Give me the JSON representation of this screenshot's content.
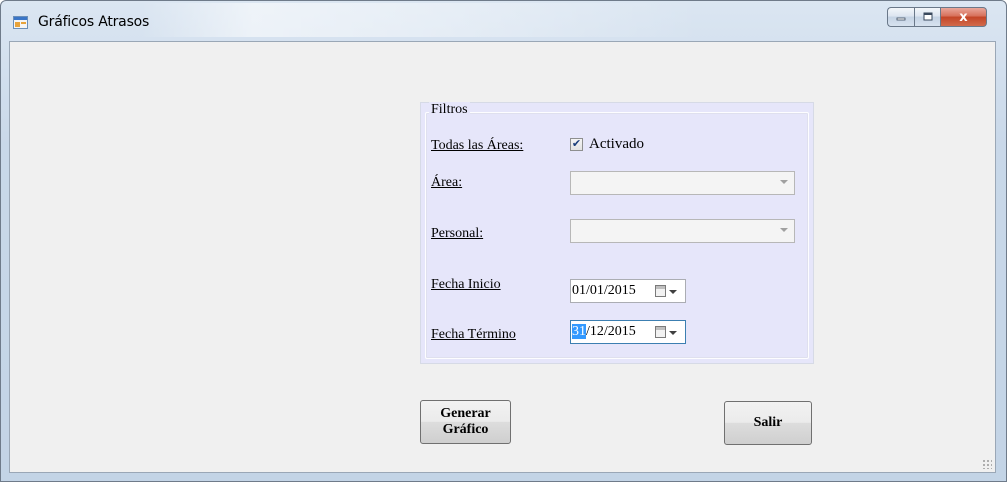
{
  "window": {
    "title": "Gráficos Atrasos",
    "close_glyph": "x",
    "icons": {
      "app": "form-icon",
      "minimize": "minimize-icon",
      "maximize": "maximize-icon",
      "close": "close-icon"
    }
  },
  "filters": {
    "group_title": "Filtros",
    "all_areas": {
      "label": "Todas las Áreas:",
      "checked": true,
      "checkbox_text": "Activado"
    },
    "area": {
      "label": "Área:",
      "value": "",
      "enabled": false
    },
    "personal": {
      "label": "Personal:",
      "value": "",
      "enabled": false
    },
    "start_date": {
      "label": "Fecha Inicio",
      "value": "01/01/2015"
    },
    "end_date": {
      "label": "Fecha Término",
      "value_day": "31",
      "value_rest": "/12/2015"
    }
  },
  "buttons": {
    "generate": "Generar\nGráfico",
    "exit": "Salir"
  },
  "colors": {
    "group_background": "#e6e6fa",
    "client_background": "#f0f0f0",
    "selection": "#3399ff"
  }
}
